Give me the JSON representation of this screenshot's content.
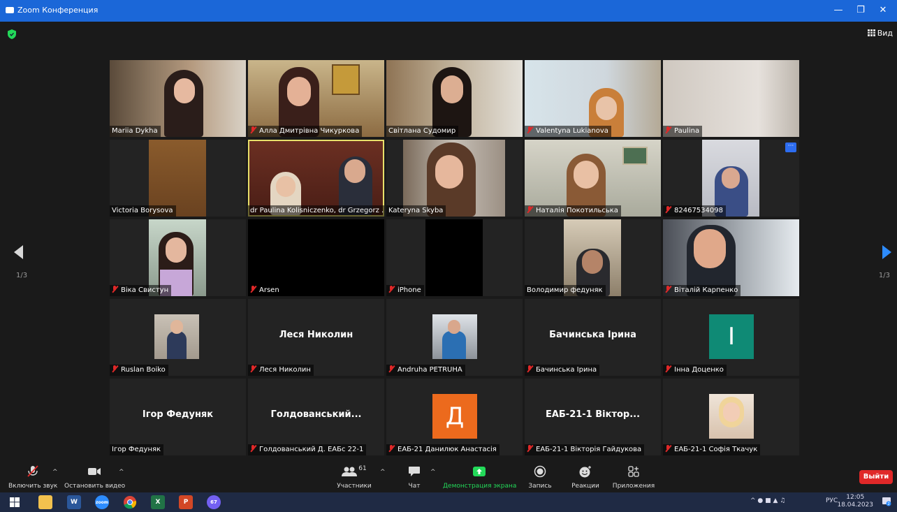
{
  "window": {
    "title": "Zoom Конференция",
    "controls": [
      "—",
      "❐",
      "✕"
    ]
  },
  "header": {
    "view_label": "Вид"
  },
  "pagination": {
    "left": "1/3",
    "right": "1/3"
  },
  "participants": [
    {
      "name": "Mariia Dykha",
      "muted": false
    },
    {
      "name": "Алла Дмитрівна Чикуркова",
      "muted": true
    },
    {
      "name": "Світлана Судомир",
      "muted": false
    },
    {
      "name": "Valentyna Lukianova",
      "muted": true
    },
    {
      "name": "Paulina",
      "muted": true
    },
    {
      "name": "Victoria Borysova",
      "muted": false
    },
    {
      "name": "dr Paulina Kolisniczenko, dr Grzegorz ...",
      "muted": false,
      "active_speaker": true
    },
    {
      "name": "Kateryna Skyba",
      "muted": false
    },
    {
      "name": "Наталія Покотильська",
      "muted": true
    },
    {
      "name": "82467534098",
      "muted": true,
      "more": "···"
    },
    {
      "name": "Віка Свистун",
      "muted": true
    },
    {
      "name": "Arsen",
      "muted": true
    },
    {
      "name": "iPhone",
      "muted": true
    },
    {
      "name": "Володимир федуняк",
      "muted": false
    },
    {
      "name": "Віталій Карпенко",
      "muted": true
    },
    {
      "name": "Ruslan Boiko",
      "muted": true
    },
    {
      "name": "Леся Николин",
      "muted": true,
      "big_name": "Леся Николин"
    },
    {
      "name": "Andruha PETRUHA",
      "muted": true
    },
    {
      "name": "Бачинська Ірина",
      "muted": true,
      "big_name": "Бачинська Ірина"
    },
    {
      "name": "Інна Доценко",
      "muted": true,
      "avatar_letter": "I"
    },
    {
      "name": "Ігор Федуняк",
      "muted": false,
      "big_name": "Ігор Федуняк"
    },
    {
      "name": "Голдованський Д. ЕАБс 22-1",
      "muted": true,
      "big_name": "Голдованський..."
    },
    {
      "name": "ЕАБ-21 Данилюк Анастасія",
      "muted": true,
      "avatar_letter": "Д"
    },
    {
      "name": "ЕАБ-21-1 Вікторія Гайдукова",
      "muted": true,
      "big_name": "ЕАБ-21-1 Віктор..."
    },
    {
      "name": "ЕАБ-21-1 Софія Ткачук",
      "muted": true
    }
  ],
  "toolbar": {
    "unmute": "Включить звук",
    "stop_video": "Остановить видео",
    "participants": "Участники",
    "participants_count": "61",
    "chat": "Чат",
    "share_screen": "Демонстрация экрана",
    "record": "Запись",
    "reactions": "Реакции",
    "apps": "Приложения",
    "leave": "Выйти",
    "caret": "^"
  },
  "taskbar": {
    "word_label": "W",
    "zoom_label": "zoom",
    "excel_label": "X",
    "ppt_label": "P",
    "viber_badge": "67",
    "tray_lang": "РУС",
    "time": "12:05",
    "date": "18.04.2023",
    "notif_count": "2"
  },
  "colors": {
    "accent_blue": "#1b67d8",
    "share_green": "#23d959",
    "leave_red": "#e02828",
    "active_speaker": "#e8e06a"
  }
}
